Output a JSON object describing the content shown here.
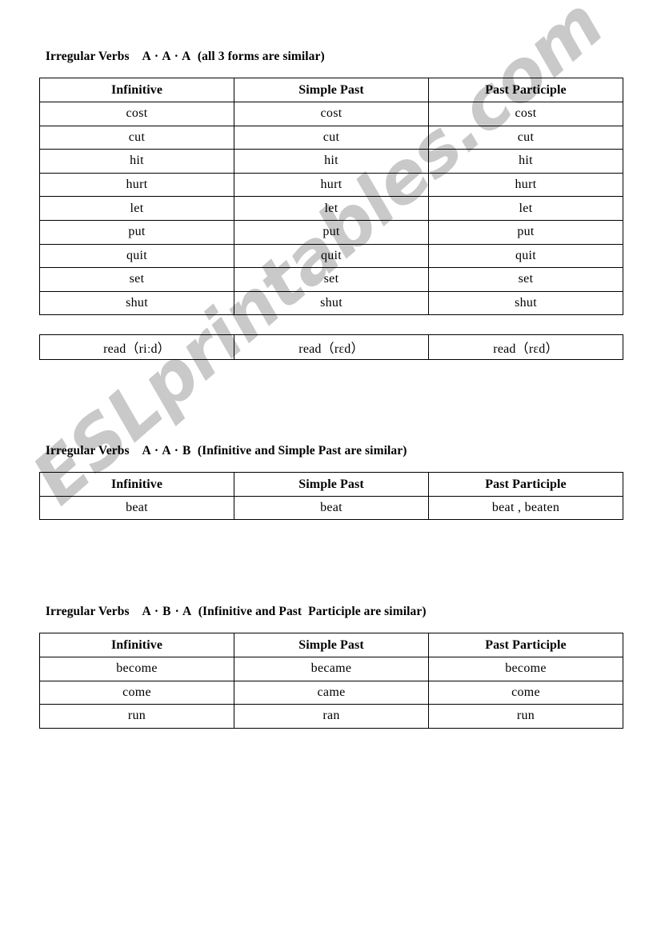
{
  "document": {
    "watermark": "ESLprintables.com",
    "columns": [
      "Infinitive",
      "Simple Past",
      "Past Participle"
    ]
  },
  "sections": [
    {
      "title": "Irregular Verbs",
      "code": "A · A · A",
      "note": "(all 3 forms are similar)",
      "headers": [
        "Infinitive",
        "Simple Past",
        "Past Participle"
      ],
      "rows": [
        [
          "cost",
          "cost",
          "cost"
        ],
        [
          "cut",
          "cut",
          "cut"
        ],
        [
          "hit",
          "hit",
          "hit"
        ],
        [
          "hurt",
          "hurt",
          "hurt"
        ],
        [
          "let",
          "let",
          "let"
        ],
        [
          "put",
          "put",
          "put"
        ],
        [
          "quit",
          "quit",
          "quit"
        ],
        [
          "set",
          "set",
          "set"
        ],
        [
          "shut",
          "shut",
          "shut"
        ]
      ],
      "extra_row": [
        "read（riːd）",
        "read（rɛd）",
        "read（rɛd）"
      ]
    },
    {
      "title": "Irregular Verbs",
      "code": "A · A · B",
      "note": "(Infinitive and Simple Past are similar)",
      "headers": [
        "Infinitive",
        "Simple Past",
        "Past Participle"
      ],
      "rows": [
        [
          "beat",
          "beat",
          "beat , beaten"
        ]
      ]
    },
    {
      "title": "Irregular Verbs",
      "code": "A · B · A",
      "note": "(Infinitive and Past  Participle are similar)",
      "headers": [
        "Infinitive",
        "Simple Past",
        "Past Participle"
      ],
      "rows": [
        [
          "become",
          "became",
          "become"
        ],
        [
          "come",
          "came",
          "come"
        ],
        [
          "run",
          "ran",
          "run"
        ]
      ]
    }
  ]
}
